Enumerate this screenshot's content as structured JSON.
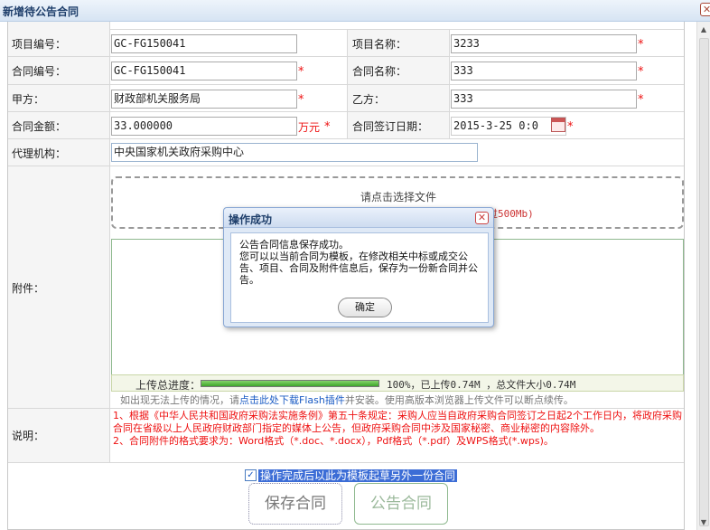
{
  "window": {
    "title": "新增待公告合同"
  },
  "form": {
    "project_no": {
      "label": "项目编号：",
      "value": "GC-FG150041"
    },
    "project_name": {
      "label": "项目名称：",
      "value": "3233"
    },
    "contract_no": {
      "label": "合同编号：",
      "value": "GC-FG150041"
    },
    "contract_name": {
      "label": "合同名称：",
      "value": "333"
    },
    "party_a": {
      "label": "甲方：",
      "value": "财政部机关服务局"
    },
    "party_b": {
      "label": "乙方：",
      "value": "333"
    },
    "amount": {
      "label": "合同金额：",
      "value": "33.000000",
      "unit": "万元"
    },
    "sign_date": {
      "label": "合同签订日期：",
      "value": "2015-3-25 0:0"
    },
    "agency": {
      "label": "代理机构：",
      "value": "中央国家机关政府采购中心"
    },
    "required_mark": "*"
  },
  "attachments": {
    "label": "附件：",
    "drop_tip": "请点击选择文件",
    "size_hint": "过500Mb)",
    "progress_label": "上传总进度：",
    "progress": 1.0,
    "progress_text": "100%，已上传0.74M ，总文件大小0.74M",
    "fallback_prefix": "如出现无法上传的情况，请",
    "fallback_link": "点击此处下载Flash插件",
    "fallback_suffix": "并安装。使用高版本浏览器上传文件可以断点续传。"
  },
  "notes": {
    "label": "说明：",
    "line1": "1、根据《中华人民共和国政府采购法实施条例》第五十条规定：采购人应当自政府采购合同签订之日起2个工作日内，将政府采购合同在省级以上人民政府财政部门指定的媒体上公告，但政府采购合同中涉及国家秘密、商业秘密的内容除外。",
    "line2": "2、合同附件的格式要求为：Word格式（*.doc、*.docx），Pdf格式（*.pdf）及WPS格式(*.wps)。"
  },
  "actions": {
    "template_checkbox": "操作完成后以此为模板起草另外一份合同",
    "template_checked": true,
    "check_mark": "✓",
    "save": "保存合同",
    "publish": "公告合同"
  },
  "dialog": {
    "title": "操作成功",
    "line1": "公告合同信息保存成功。",
    "line2": "您可以以当前合同为模板，在修改相关中标或成交公告、项目、合同及附件信息后，保存为一份新合同并公告。",
    "ok": "确定"
  },
  "icons": {
    "close": "close-icon",
    "calendar": "calendar-icon"
  },
  "colors": {
    "required": "#ee1111",
    "accent": "#1f3f6b",
    "progress": "#3ea52a"
  }
}
